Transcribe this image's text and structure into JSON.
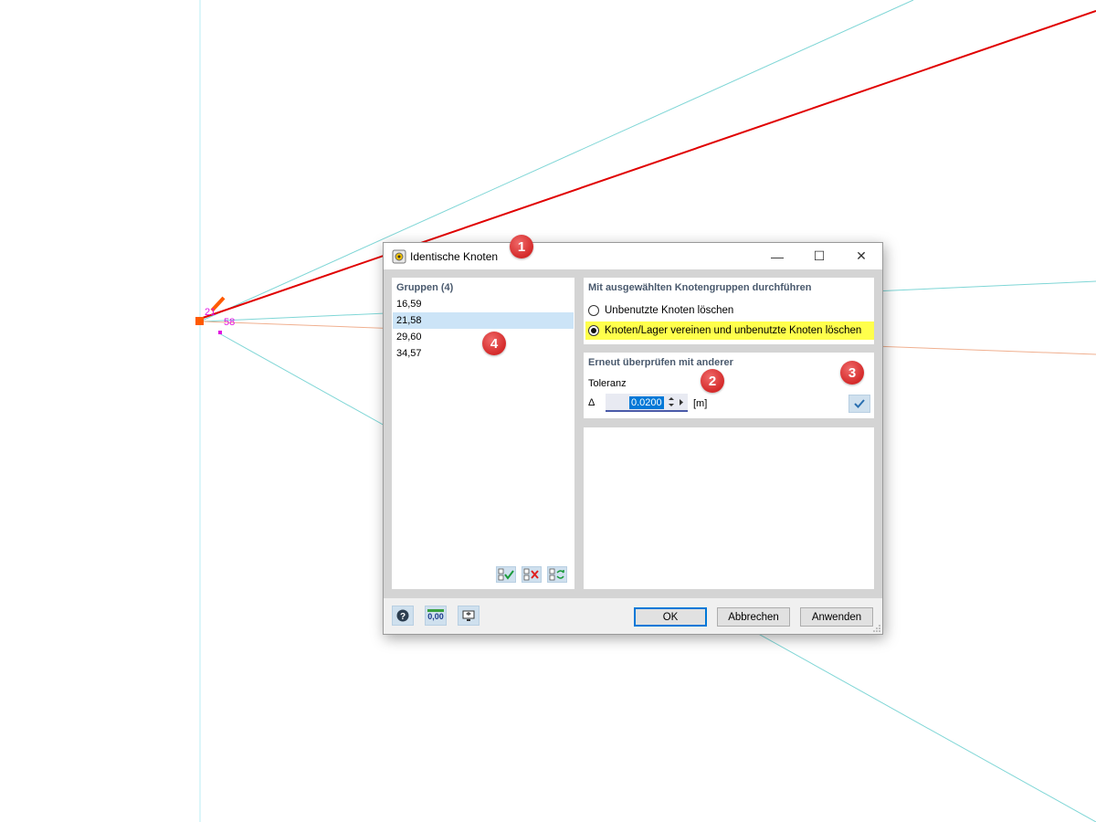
{
  "canvas": {
    "node_labels": {
      "a": "21",
      "b": "58"
    },
    "colors": {
      "cyan_line": "#7fd6d6",
      "red_member": "#e00000",
      "orange_line": "#f0b090",
      "node_orange": "#ff5a00",
      "node_magenta": "#e010e0"
    }
  },
  "dialog": {
    "title": "Identische Knoten",
    "window_buttons": {
      "minimize": "—",
      "maximize": "☐",
      "close": "✕"
    },
    "groups": {
      "header": "Gruppen (4)",
      "items": [
        "16,59",
        "21,58",
        "29,60",
        "34,57"
      ],
      "selected_index": 1
    },
    "action": {
      "header": "Mit ausgewählten Knotengruppen durchführen",
      "options": [
        "Unbenutzte Knoten löschen",
        "Knoten/Lager vereinen und unbenutzte Knoten löschen"
      ],
      "selected_index": 1
    },
    "recheck": {
      "header": "Erneut überprüfen mit anderer",
      "tolerance_label": "Toleranz",
      "delta_symbol": "Δ",
      "tolerance_value": "0.0200",
      "unit": "[m]"
    },
    "footer": {
      "units_icon_text": "0,00",
      "ok": "OK",
      "cancel": "Abbrechen",
      "apply": "Anwenden"
    }
  },
  "annotations": [
    "1",
    "2",
    "3",
    "4"
  ]
}
